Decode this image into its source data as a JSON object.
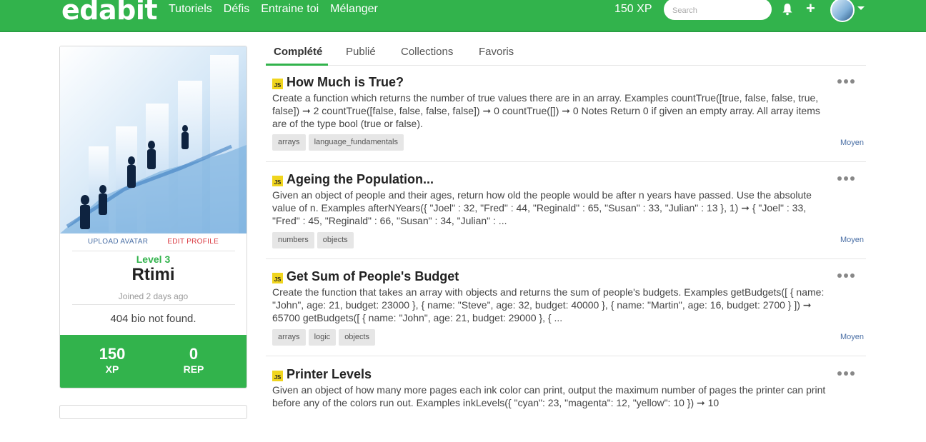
{
  "header": {
    "logo": "edabit",
    "nav": [
      "Tutoriels",
      "Défis",
      "Entraine toi",
      "Mélanger"
    ],
    "xp": "150 XP",
    "search_placeholder": "Search",
    "plus": "+"
  },
  "profile": {
    "upload_avatar": "UPLOAD AVATAR",
    "edit_profile": "EDIT PROFILE",
    "level": "Level 3",
    "username": "Rtimi",
    "joined": "Joined 2 days ago",
    "bio": "404 bio not found.",
    "xp_value": "150",
    "xp_label": "XP",
    "rep_value": "0",
    "rep_label": "REP"
  },
  "tabs": [
    "Complété",
    "Publié",
    "Collections",
    "Favoris"
  ],
  "challenges": [
    {
      "lang": "JS",
      "title": "How Much is True?",
      "description": "Create a function which returns the number of true values there are in an array. Examples countTrue([true, false, false, true, false]) ➞ 2 countTrue([false, false, false, false]) ➞ 0 countTrue([]) ➞ 0 Notes Return 0 if given an empty array. All array items are of the type bool (true or false).",
      "tags": [
        "arrays",
        "language_fundamentals"
      ],
      "difficulty": "Moyen"
    },
    {
      "lang": "JS",
      "title": "Ageing the Population...",
      "description": "Given an object of people and their ages, return how old the people would be after n years have passed. Use the absolute value of n. Examples afterNYears({ \"Joel\" : 32, \"Fred\" : 44, \"Reginald\" : 65, \"Susan\" : 33, \"Julian\" : 13 }, 1) ➞ { \"Joel\" : 33, \"Fred\" : 45, \"Reginald\" : 66, \"Susan\" : 34, \"Julian\" : ...",
      "tags": [
        "numbers",
        "objects"
      ],
      "difficulty": "Moyen"
    },
    {
      "lang": "JS",
      "title": "Get Sum of People's Budget",
      "description": "Create the function that takes an array with objects and returns the sum of people's budgets. Examples getBudgets([ { name: \"John\", age: 21, budget: 23000 }, { name: \"Steve\", age: 32, budget: 40000 }, { name: \"Martin\", age: 16, budget: 2700 } ]) ➞ 65700 getBudgets([ { name: \"John\", age: 21, budget: 29000 }, { ...",
      "tags": [
        "arrays",
        "logic",
        "objects"
      ],
      "difficulty": "Moyen"
    },
    {
      "lang": "JS",
      "title": "Printer Levels",
      "description": "Given an object of how many more pages each ink color can print, output the maximum number of pages the printer can print before any of the colors run out. Examples inkLevels({ \"cyan\": 23, \"magenta\": 12, \"yellow\": 10 }) ➞ 10",
      "tags": [],
      "difficulty": ""
    }
  ]
}
